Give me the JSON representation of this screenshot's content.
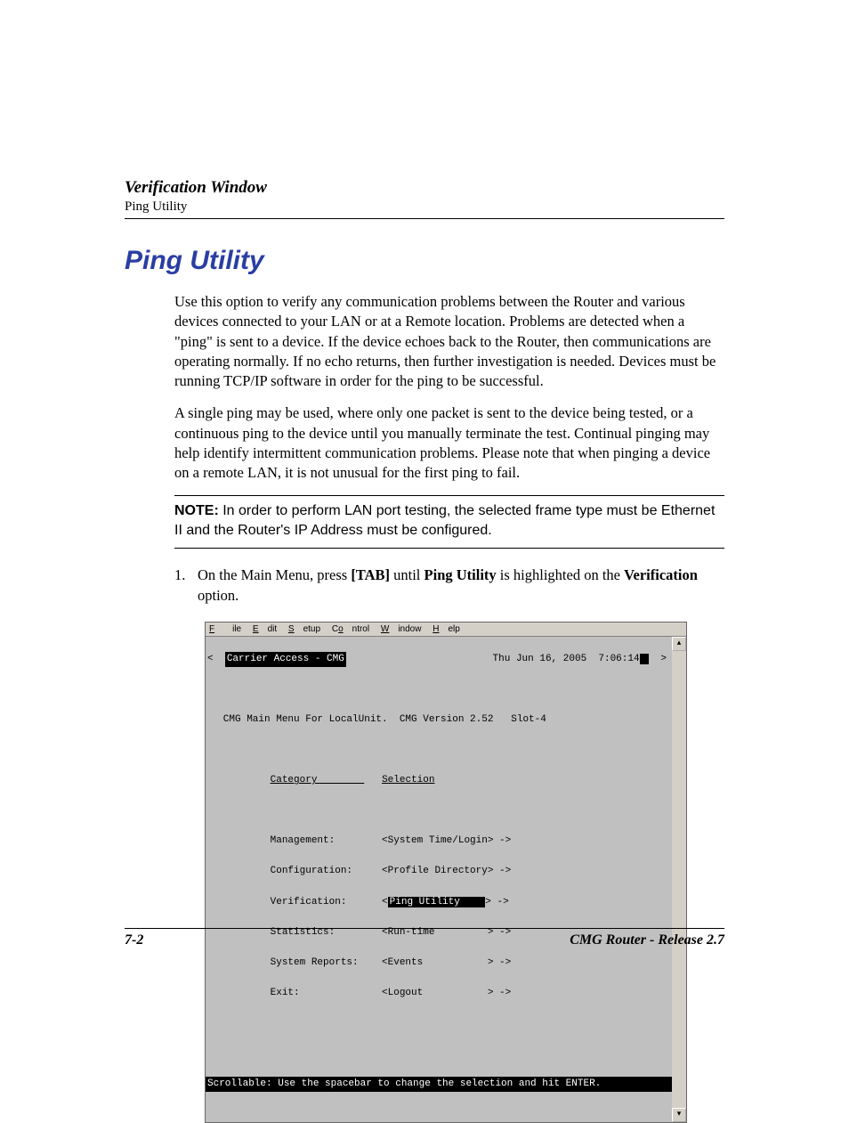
{
  "header": {
    "chapter": "Verification Window",
    "subsection": "Ping Utility"
  },
  "title": "Ping Utility",
  "para1": "Use this option to verify any communication problems between the Router and various devices connected to your LAN or at a Remote location. Problems are detected when a \"ping\" is sent to a device. If the device echoes back to the Router, then communications are operating normally. If no echo returns, then further investigation is needed. Devices must be running TCP/IP software in order for the ping to be successful.",
  "para2": "A single ping may be used, where only one packet is sent to the device being tested, or a continuous ping to the device until you manually terminate the test. Continual pinging may help identify intermittent communication problems. Please note that when pinging a device on a remote LAN, it is not unusual for the first ping to fail.",
  "note": {
    "label": "NOTE:",
    "text": "  In order to perform LAN port testing, the selected frame type must be Ethernet II and the Router's IP Address must be configured."
  },
  "step1": {
    "num": "1.",
    "pre": "On the Main Menu, press ",
    "key": "[TAB]",
    "mid": " until ",
    "target": "Ping Utility",
    "post1": " is highlighted on the ",
    "opt": "Verification",
    "post2": " option."
  },
  "menubar": [
    "File",
    "Edit",
    "Setup",
    "Control",
    "Window",
    "Help"
  ],
  "terminal": {
    "title_left": "Carrier Access - CMG",
    "gt": ">",
    "lt": "<",
    "title_date": "Thu Jun 16, 2005  7:06:14",
    "line_menu": "   CMG Main Menu For LocalUnit.  CMG Version 2.52   Slot-4",
    "hdr_cat": "Category        ",
    "hdr_sel": "Selection",
    "rows": [
      {
        "cat": "Management:",
        "sel": "<System Time/Login> ->",
        "hl": false
      },
      {
        "cat": "Configuration:",
        "sel": "<Profile Directory> ->",
        "hl": false
      },
      {
        "cat": "Verification:",
        "sel": "Ping Utility",
        "hl": true
      },
      {
        "cat": "Statistics:",
        "sel": "<Run-time         > ->",
        "hl": false
      },
      {
        "cat": "System Reports:",
        "sel": "<Events           > ->",
        "hl": false
      },
      {
        "cat": "Exit:",
        "sel": "<Logout           > ->",
        "hl": false
      }
    ],
    "footer_line": "Scrollable: Use the spacebar to change the selection and hit ENTER."
  },
  "footer": {
    "left": "7-2",
    "right": "CMG Router - Release 2.7"
  }
}
